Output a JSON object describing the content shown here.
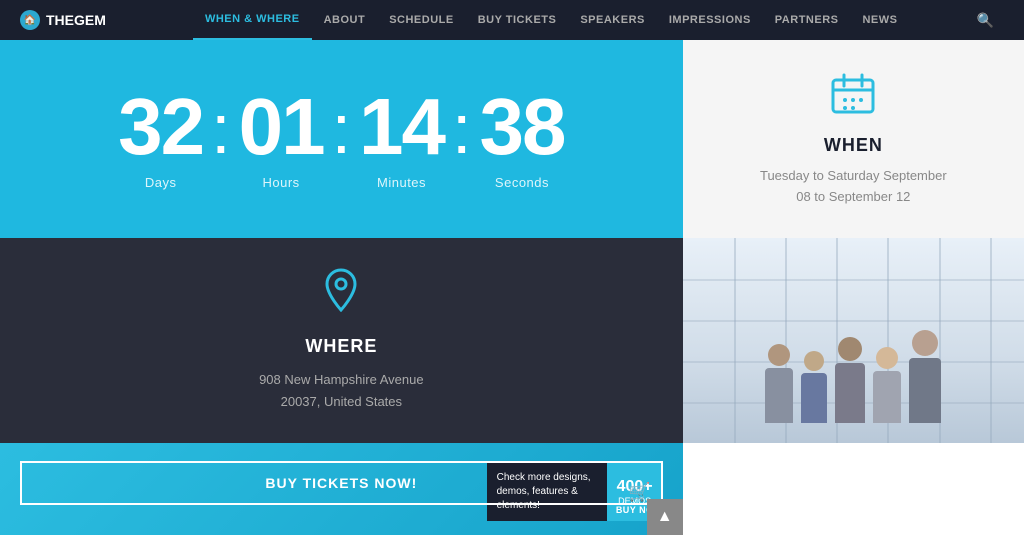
{
  "navbar": {
    "logo_text": "THEGEM",
    "nav_items": [
      {
        "label": "WHEN & WHERE",
        "active": true
      },
      {
        "label": "ABOUT",
        "active": false
      },
      {
        "label": "SCHEDULE",
        "active": false
      },
      {
        "label": "BUY TICKETS",
        "active": false
      },
      {
        "label": "SPEAKERS",
        "active": false
      },
      {
        "label": "IMPRESSIONS",
        "active": false
      },
      {
        "label": "PARTNERS",
        "active": false
      },
      {
        "label": "NEWS",
        "active": false
      }
    ]
  },
  "countdown": {
    "days_value": "32",
    "days_label": "Days",
    "hours_value": "01",
    "hours_label": "Hours",
    "minutes_value": "14",
    "minutes_label": "Minutes",
    "seconds_value": "38",
    "seconds_label": "Seconds"
  },
  "when": {
    "title": "WHEN",
    "date_line1": "Tuesday to Saturday September",
    "date_line2": "08 to September 12"
  },
  "where": {
    "title": "WHERE",
    "address_line1": "908 New Hampshire Avenue",
    "address_line2": "20037, United States"
  },
  "promo": {
    "demos_text": "Check more designs, demos, features & elements!",
    "demos_count": "400+",
    "demos_label": "DEMOS",
    "buy_tickets_label": "BUY TICKETS NOW!",
    "buy_now_label": "BUY NOW"
  }
}
